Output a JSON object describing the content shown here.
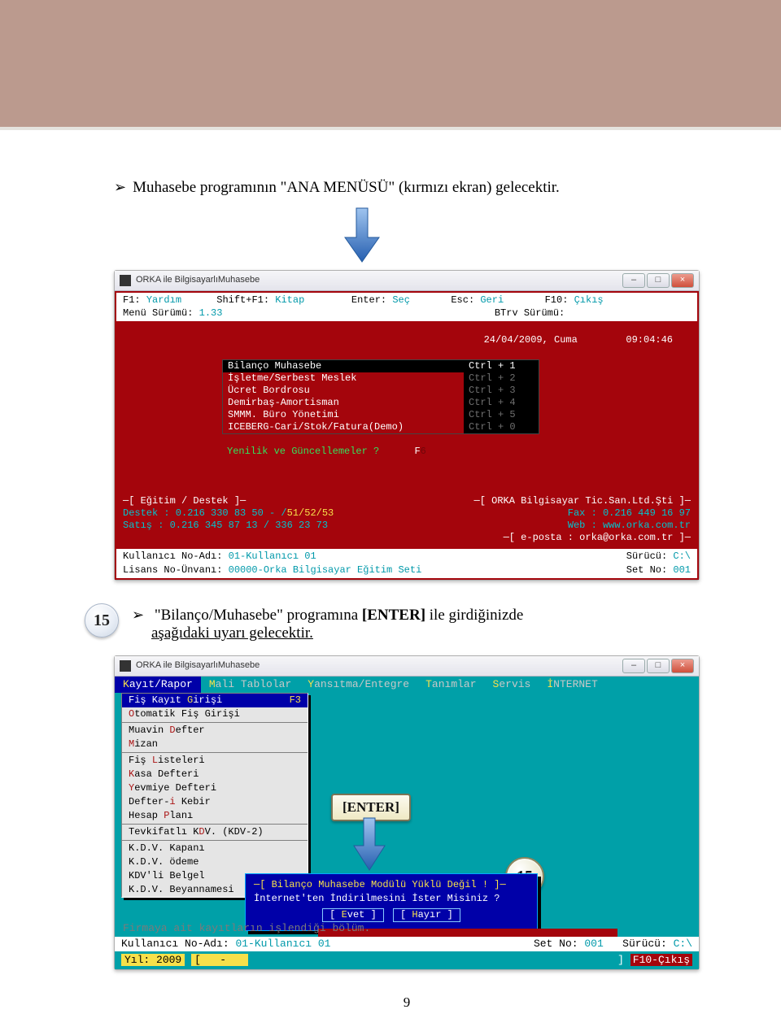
{
  "doc": {
    "bullet1": "Muhasebe programının \"ANA MENÜSÜ\" (kırmızı ekran) gelecektir.",
    "step_num": "15",
    "step_text_a": "\"Bilanço/Muhasebe\" programına ",
    "step_text_bold": "[ENTER]",
    "step_text_b": " ile girdiğinizde",
    "step_text_c": "aşağıdaki uyarı gelecektir.",
    "page_number": "9"
  },
  "win": {
    "title": "ORKA ile BilgisayarlıMuhasebe",
    "btn_min": "–",
    "btn_max": "□",
    "btn_close": "×"
  },
  "screen1": {
    "help": {
      "f1": "F1:",
      "yardim": "Yardım",
      "sf1": "Shift+F1:",
      "kitap": "Kitap",
      "enter": "Enter:",
      "sec": "Seç",
      "esc": "Esc:",
      "geri": "Geri",
      "f10": "F10:",
      "cikis": "Çıkış"
    },
    "menu_version_label": "Menü Sürümü:",
    "menu_version": "1.33",
    "btrv_label": "BTrv Sürümü:",
    "date": "24/04/2009, Cuma",
    "time": "09:04:46",
    "items": [
      {
        "label": "Bilanço Muhasebe",
        "shortcut": "Ctrl + 1",
        "selected": true
      },
      {
        "label": "İşletme/Serbest Meslek",
        "shortcut": "Ctrl + 2",
        "selected": false
      },
      {
        "label": "Ücret Bordrosu",
        "shortcut": "Ctrl + 3",
        "selected": false
      },
      {
        "label": "Demirbaş-Amortisman",
        "shortcut": "Ctrl + 4",
        "selected": false
      },
      {
        "label": "SMMM. Büro Yönetimi",
        "shortcut": "Ctrl + 5",
        "selected": false
      },
      {
        "label": "ICEBERG-Cari/Stok/Fatura(Demo)",
        "shortcut": "Ctrl + 0",
        "selected": false
      }
    ],
    "updates_label": "Yenilik ve Güncellemeler ?",
    "updates_key": "F6",
    "box_left_title": "─[ Eğitim / Destek ]─",
    "box_left_l1a": "Destek : 0.216 330 83 50 - /",
    "box_left_l1b": "51/52/53",
    "box_left_l2": "Satış  : 0.216 345 87 13 / 336 23 73",
    "box_right_title": "─[ ORKA Bilgisayar Tic.San.Ltd.Şti ]─",
    "box_right_l1": "Fax : 0.216 449 16 97",
    "box_right_l2": "Web :  www.orka.com.tr",
    "box_right_l3": "─[ e-posta : orka@orka.com.tr ]─",
    "user_label": "Kullanıcı No-Adı:",
    "user_value": "01-Kullanıcı 01",
    "drive_label": "Sürücü:",
    "drive_value": "C:\\",
    "license_label": "Lisans No-Ünvanı:",
    "license_value": "00000-Orka Bilgisayar Eğitim Seti",
    "setno_label": "Set No:",
    "setno_value": "001"
  },
  "enter_tag": "[ENTER]",
  "screen2": {
    "menubar": [
      {
        "hot": "K",
        "rest": "ayıt/Rapor",
        "active": true
      },
      {
        "hot": "M",
        "rest": "ali Tablolar"
      },
      {
        "hot": "Y",
        "rest": "ansıtma/Entegre"
      },
      {
        "hot": "T",
        "rest": "anımlar"
      },
      {
        "hot": "S",
        "rest": "ervis"
      },
      {
        "hot": "İ",
        "rest": "NTERNET"
      }
    ],
    "dropdown": [
      {
        "type": "item",
        "pre": "Fiş Kayıt ",
        "hot": "G",
        "post": "irişi",
        "shortcut": "F3",
        "selected": true
      },
      {
        "type": "item",
        "pre": "",
        "hot": "O",
        "post": "tomatik Fiş Girişi"
      },
      {
        "type": "sep"
      },
      {
        "type": "item",
        "pre": "Muavin ",
        "hot": "D",
        "post": "efter"
      },
      {
        "type": "item",
        "pre": "",
        "hot": "M",
        "post": "izan"
      },
      {
        "type": "sep"
      },
      {
        "type": "item",
        "pre": "Fiş ",
        "hot": "L",
        "post": "isteleri"
      },
      {
        "type": "item",
        "pre": "",
        "hot": "K",
        "post": "asa Defteri"
      },
      {
        "type": "item",
        "pre": "",
        "hot": "Y",
        "post": "evmiye Defteri"
      },
      {
        "type": "item",
        "pre": "Defter-",
        "hot": "i",
        "post": " Kebir"
      },
      {
        "type": "item",
        "pre": "Hesap ",
        "hot": "P",
        "post": "lanı"
      },
      {
        "type": "sep"
      },
      {
        "type": "item",
        "pre": "Tevkifatlı K",
        "hot": "D",
        "post": "V. (KDV-2)"
      },
      {
        "type": "sep"
      },
      {
        "type": "item",
        "pre": "K.D.V. Kapanı"
      },
      {
        "type": "item",
        "pre": "K.D.V. ödeme"
      },
      {
        "type": "item",
        "pre": "KDV'li Belgel"
      },
      {
        "type": "item",
        "pre": "K.D.V. Beyannamesi"
      }
    ],
    "dialog": {
      "title": "─[  Bilanço Muhasebe Modülü Yüklü Değil ! ]─",
      "question": "İnternet'ten İndirilmesini İster Misiniz ?",
      "yes_h": "E",
      "yes_r": "vet",
      "no_h": "H",
      "no_r": "ayır"
    },
    "tag15": "15",
    "hint": "Firmaya ait kayıtların işlendiği bölüm.",
    "user_label": "Kullanıcı No-Adı:",
    "user_value": "01-Kullanıcı 01",
    "setno_label": "Set No:",
    "setno_value": "001",
    "drive_label": "Sürücü:",
    "drive_value": "C:\\",
    "year_label": "Yıl:",
    "year_value": "2009",
    "f10": "F10-Çıkış"
  }
}
